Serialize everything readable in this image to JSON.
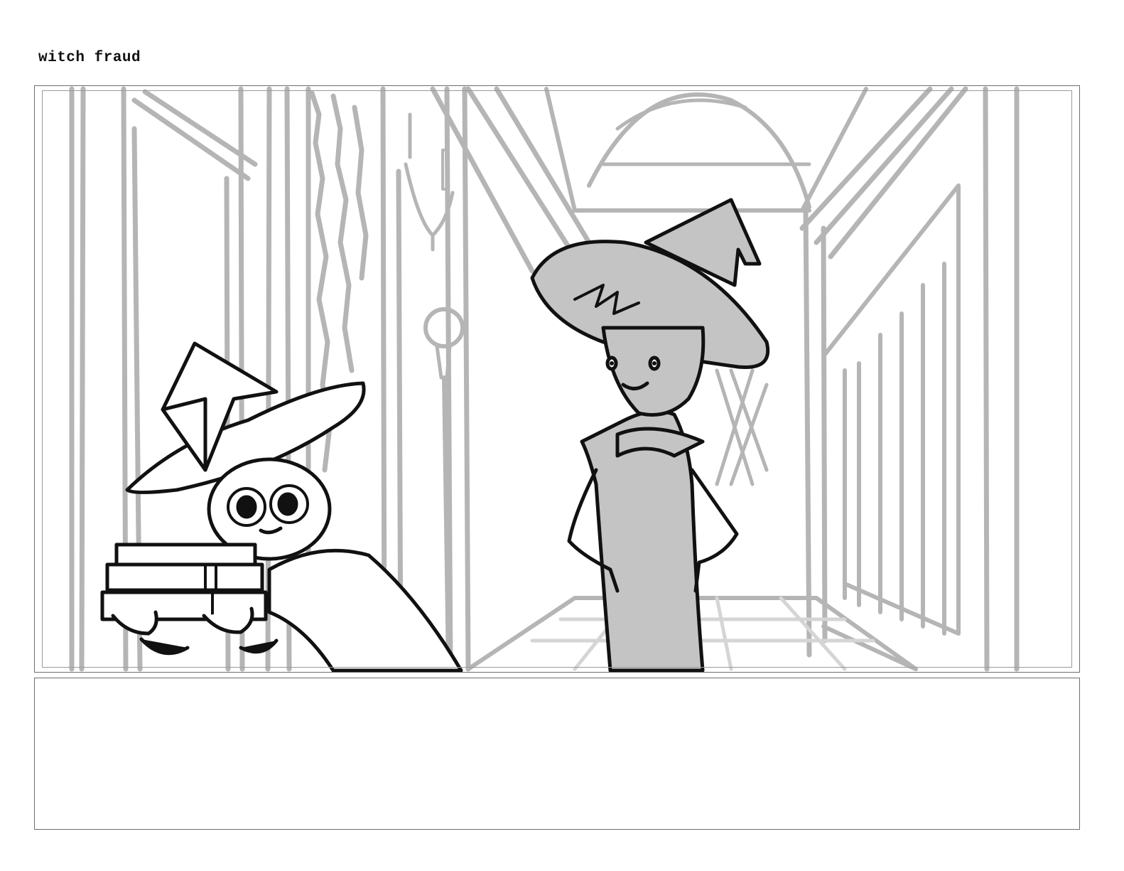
{
  "sheet": {
    "title": "witch fraud"
  },
  "panel": {
    "notes": ""
  },
  "colors": {
    "background_sketch": "#b5b5b5",
    "character_fill": "#c4c4c4",
    "ink": "#111111",
    "frame": "#6e6e6e"
  }
}
